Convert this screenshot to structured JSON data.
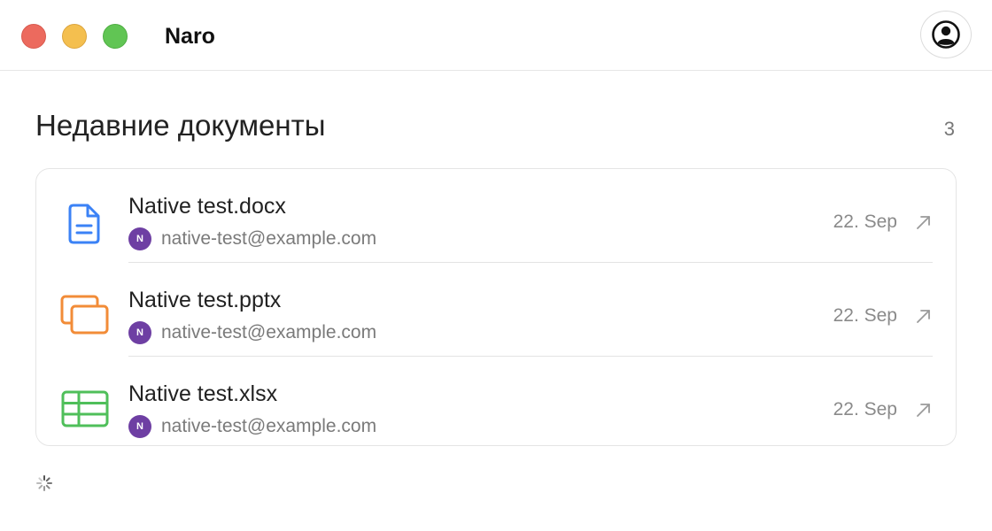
{
  "app": {
    "title": "Naro",
    "window_controls": [
      "close",
      "minimize",
      "zoom"
    ],
    "account_icon": "user-circle-icon"
  },
  "recent": {
    "title": "Недавние документы",
    "count": "3",
    "documents": [
      {
        "name": "Native test.docx",
        "type": "document",
        "icon": "document-icon",
        "icon_color": "#3b82f6",
        "owner_initial": "N",
        "owner_email": "native-test@example.com",
        "date": "22. Sep",
        "action_icon": "arrow-up-right-icon"
      },
      {
        "name": "Native test.pptx",
        "type": "presentation",
        "icon": "presentation-icon",
        "icon_color": "#f28c38",
        "owner_initial": "N",
        "owner_email": "native-test@example.com",
        "date": "22. Sep",
        "action_icon": "arrow-up-right-icon"
      },
      {
        "name": "Native test.xlsx",
        "type": "spreadsheet",
        "icon": "spreadsheet-icon",
        "icon_color": "#4fbf5a",
        "owner_initial": "N",
        "owner_email": "native-test@example.com",
        "date": "22. Sep",
        "action_icon": "arrow-up-right-icon"
      }
    ]
  },
  "colors": {
    "avatar": "#6e3fa3",
    "close": "#ec6a5e",
    "minimize": "#f4bf4f",
    "zoom": "#61c554"
  },
  "loading_icon": "spinner-icon"
}
